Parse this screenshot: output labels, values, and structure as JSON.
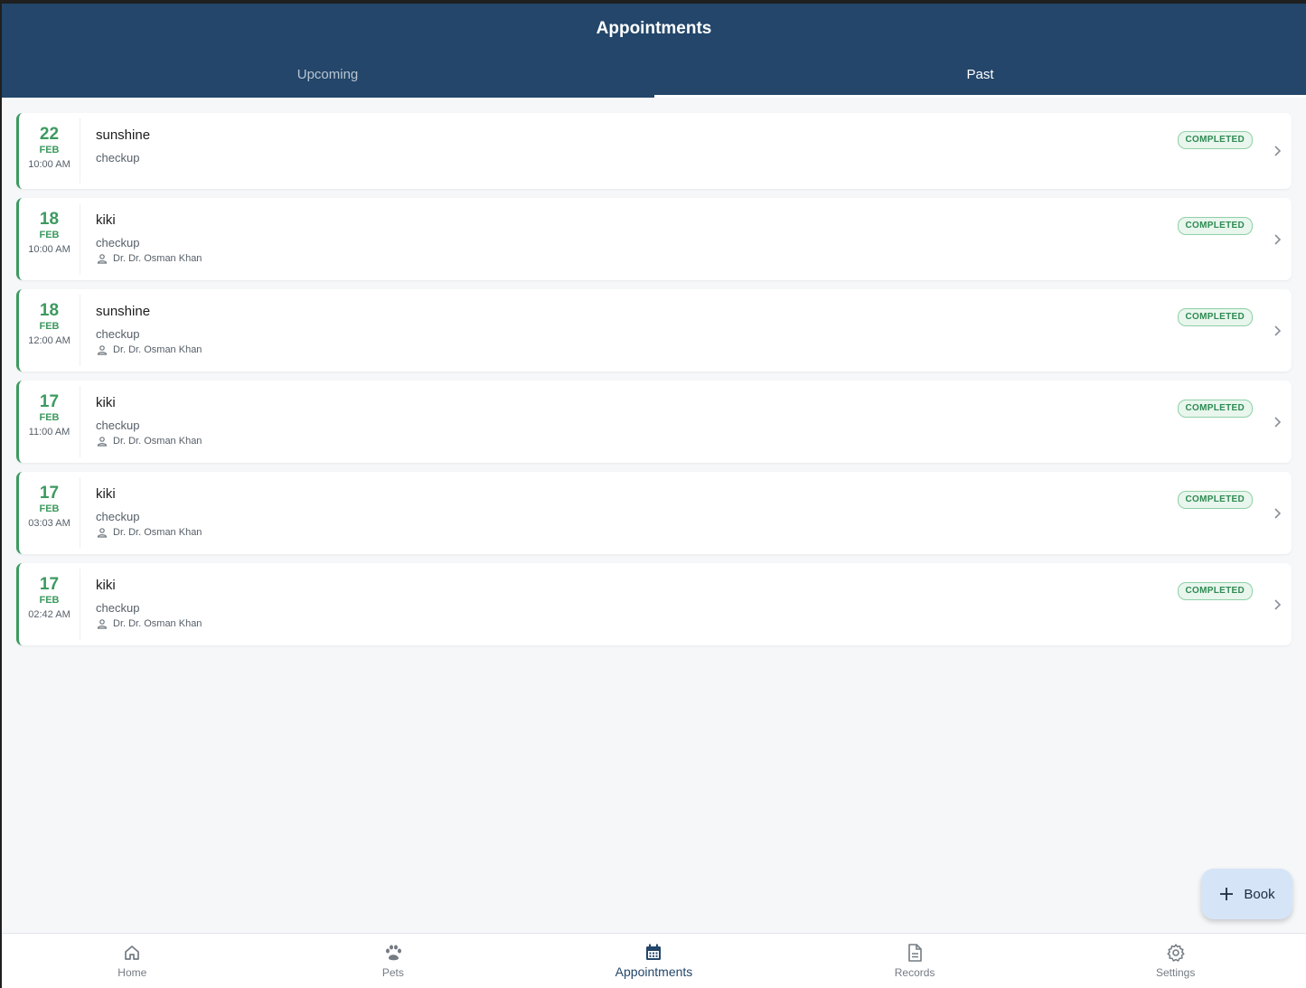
{
  "header": {
    "title": "Appointments",
    "tabs": [
      {
        "label": "Upcoming",
        "active": false
      },
      {
        "label": "Past",
        "active": true
      }
    ]
  },
  "appointments": [
    {
      "day": "22",
      "month": "FEB",
      "time": "10:00 AM",
      "pet": "sunshine",
      "type": "checkup",
      "vet": "",
      "status": "COMPLETED"
    },
    {
      "day": "18",
      "month": "FEB",
      "time": "10:00 AM",
      "pet": "kiki",
      "type": "checkup",
      "vet": "Dr. Dr. Osman Khan",
      "status": "COMPLETED"
    },
    {
      "day": "18",
      "month": "FEB",
      "time": "12:00 AM",
      "pet": "sunshine",
      "type": "checkup",
      "vet": "Dr. Dr. Osman Khan",
      "status": "COMPLETED"
    },
    {
      "day": "17",
      "month": "FEB",
      "time": "11:00 AM",
      "pet": "kiki",
      "type": "checkup",
      "vet": "Dr. Dr. Osman Khan",
      "status": "COMPLETED"
    },
    {
      "day": "17",
      "month": "FEB",
      "time": "03:03 AM",
      "pet": "kiki",
      "type": "checkup",
      "vet": "Dr. Dr. Osman Khan",
      "status": "COMPLETED"
    },
    {
      "day": "17",
      "month": "FEB",
      "time": "02:42 AM",
      "pet": "kiki",
      "type": "checkup",
      "vet": "Dr. Dr. Osman Khan",
      "status": "COMPLETED"
    }
  ],
  "fab": {
    "label": "Book",
    "icon": "plus-icon"
  },
  "bottom_nav": [
    {
      "label": "Home",
      "icon": "home-icon",
      "active": false
    },
    {
      "label": "Pets",
      "icon": "paw-icon",
      "active": false
    },
    {
      "label": "Appointments",
      "icon": "calendar-icon",
      "active": true
    },
    {
      "label": "Records",
      "icon": "document-icon",
      "active": false
    },
    {
      "label": "Settings",
      "icon": "gear-icon",
      "active": false
    }
  ],
  "colors": {
    "header_bg": "#23466a",
    "accent_green": "#3c9a5f",
    "background": "#f5f7f9",
    "fab_bg": "#d6e4f7"
  }
}
